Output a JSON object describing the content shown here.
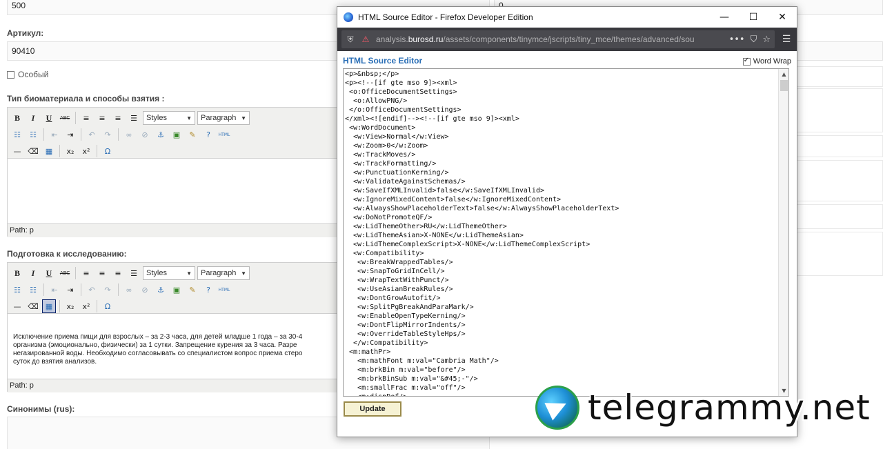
{
  "form": {
    "price_value": "500",
    "right_top_value": "0",
    "article_label": "Артикул:",
    "article_value": "90410",
    "special_label": "Особый",
    "biomaterial_label": "Тип биоматериала и способы взятия :",
    "preparation_label": "Подготовка к исследованию:",
    "synonyms_label": "Синонимы (rus):",
    "preparation_text": [
      "Исключение приема пищи для взрослых – за 2-3 часа, для детей младше 1 года – за 30-4",
      "организма (эмоционально, физически) за 1 сутки. Запрещение курения за 3 часа. Разре",
      "негазированной воды. Необходимо согласовывать со специалистом вопрос приема стеро",
      "суток до взятия анализов."
    ]
  },
  "editor_toolbar": {
    "styles_label": "Styles",
    "format_label": "Paragraph",
    "html_label": "HTML",
    "path_label": "Path: p",
    "row1": [
      "B",
      "I",
      "U",
      "ABC"
    ],
    "omega": "Ω"
  },
  "popup": {
    "window_title": "HTML Source Editor - Firefox Developer Edition",
    "url_prefix": "analysis.",
    "url_host": "burosd.ru",
    "url_path": "/assets/components/tinymce/jscripts/tiny_mce/themes/advanced/sou",
    "heading": "HTML Source Editor",
    "word_wrap_label": "Word Wrap",
    "update_label": "Update",
    "source_lines": [
      "<p>&nbsp;</p>",
      "<p><!--[if gte mso 9]><xml>",
      " <o:OfficeDocumentSettings>",
      "  <o:AllowPNG/>",
      " </o:OfficeDocumentSettings>",
      "</xml><![endif]--><!--[if gte mso 9]><xml>",
      " <w:WordDocument>",
      "  <w:View>Normal</w:View>",
      "  <w:Zoom>0</w:Zoom>",
      "  <w:TrackMoves/>",
      "  <w:TrackFormatting/>",
      "  <w:PunctuationKerning/>",
      "  <w:ValidateAgainstSchemas/>",
      "  <w:SaveIfXMLInvalid>false</w:SaveIfXMLInvalid>",
      "  <w:IgnoreMixedContent>false</w:IgnoreMixedContent>",
      "  <w:AlwaysShowPlaceholderText>false</w:AlwaysShowPlaceholderText>",
      "  <w:DoNotPromoteQF/>",
      "  <w:LidThemeOther>RU</w:LidThemeOther>",
      "  <w:LidThemeAsian>X-NONE</w:LidThemeAsian>",
      "  <w:LidThemeComplexScript>X-NONE</w:LidThemeComplexScript>",
      "  <w:Compatibility>",
      "   <w:BreakWrappedTables/>",
      "   <w:SnapToGridInCell/>",
      "   <w:WrapTextWithPunct/>",
      "   <w:UseAsianBreakRules/>",
      "   <w:DontGrowAutofit/>",
      "   <w:SplitPgBreakAndParaMark/>",
      "   <w:EnableOpenTypeKerning/>",
      "   <w:DontFlipMirrorIndents/>",
      "   <w:OverrideTableStyleHps/>",
      "  </w:Compatibility>",
      " <m:mathPr>",
      "   <m:mathFont m:val=\"Cambria Math\"/>",
      "   <m:brkBin m:val=\"before\"/>",
      "   <m:brkBinSub m:val=\"&#45;-\"/>",
      "   <m:smallFrac m:val=\"off\"/>",
      "   <m:dispDef/>"
    ]
  },
  "watermark": {
    "text": "telegrammy.net"
  },
  "colors": {
    "heading_blue": "#2b6fb6",
    "toolbar_bg": "#f0f0ee",
    "urlbar_bg": "#38383d"
  }
}
